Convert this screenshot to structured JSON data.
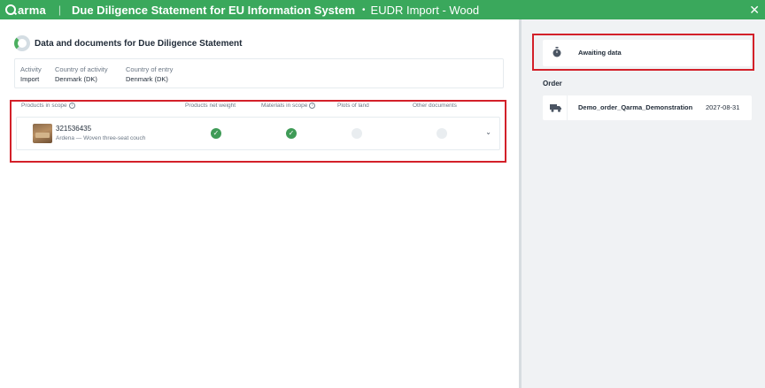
{
  "header": {
    "logo_text": "arma",
    "separator": "|",
    "title": "Due Diligence Statement for EU Information System",
    "bullet": "•",
    "subtitle": "EUDR Import - Wood",
    "close_glyph": "✕",
    "color": "#3aa85c"
  },
  "left": {
    "section_title": "Data and documents for Due Diligence Statement",
    "activity": {
      "activity_label": "Activity",
      "activity_value": "Import",
      "country_activity_label": "Country of activity",
      "country_activity_value": "Denmark (DK)",
      "country_entry_label": "Country of entry",
      "country_entry_value": "Denmark (DK)"
    },
    "products_table": {
      "headers": {
        "products_in_scope": "Products in scope",
        "products_net_weight": "Products net weight",
        "materials_in_scope": "Materials in scope",
        "plots_of_land": "Plots of land",
        "other_documents": "Other documents"
      },
      "info_glyph": "i",
      "rows": [
        {
          "id": "321536435",
          "description": "Ardena — Woven three-seat couch",
          "check_glyph": "✓",
          "chevron": "⌄"
        }
      ]
    }
  },
  "right": {
    "status": "Awaiting data",
    "order_title": "Order",
    "order": {
      "name": "Demo_order_Qarma_Demonstration",
      "date": "2027-08-31"
    }
  }
}
